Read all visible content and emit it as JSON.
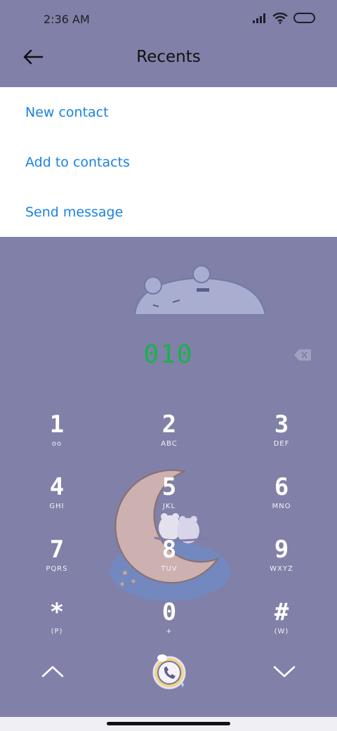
{
  "status_bar": {
    "time": "2:36 AM"
  },
  "header": {
    "title": "Recents"
  },
  "menu": {
    "items": [
      {
        "label": "New contact"
      },
      {
        "label": "Add to contacts"
      },
      {
        "label": "Send message"
      }
    ]
  },
  "dialer": {
    "number": "010",
    "keys": [
      {
        "digit": "1",
        "sub": "oo"
      },
      {
        "digit": "2",
        "sub": "ABC"
      },
      {
        "digit": "3",
        "sub": "DEF"
      },
      {
        "digit": "4",
        "sub": "GHI"
      },
      {
        "digit": "5",
        "sub": "JKL"
      },
      {
        "digit": "6",
        "sub": "MNO"
      },
      {
        "digit": "7",
        "sub": "PQRS"
      },
      {
        "digit": "8",
        "sub": "TUV"
      },
      {
        "digit": "9",
        "sub": "WXYZ"
      },
      {
        "digit": "*",
        "sub": "(P)"
      },
      {
        "digit": "0",
        "sub": "+"
      },
      {
        "digit": "#",
        "sub": "(W)"
      }
    ]
  },
  "colors": {
    "background": "#8080a8",
    "menu_text": "#1a82e0",
    "number_text": "#17b34a",
    "key_text": "#ffffff"
  },
  "icons": [
    "back-arrow-icon",
    "signal-icon",
    "wifi-icon",
    "battery-icon",
    "backspace-icon",
    "chevron-up-icon",
    "chevron-down-icon",
    "phone-icon"
  ]
}
